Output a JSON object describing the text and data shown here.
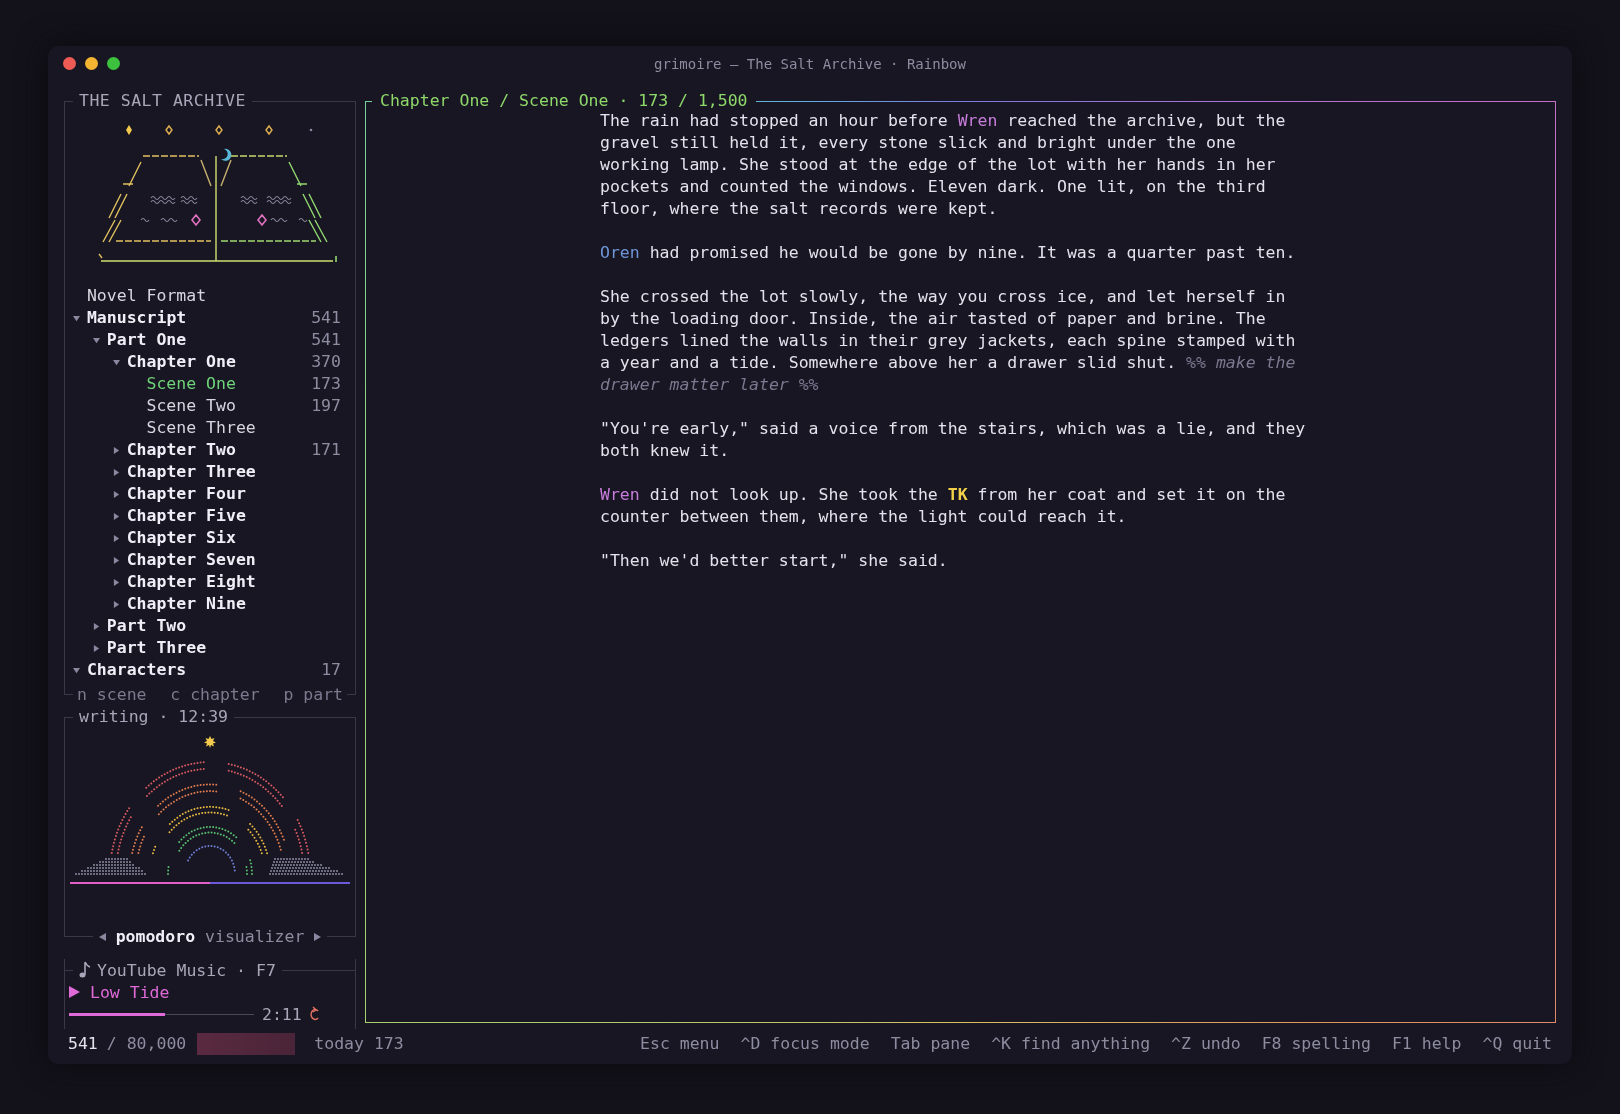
{
  "window": {
    "title": "grimoire — The Salt Archive · Rainbow"
  },
  "sidebar": {
    "title": "THE SALT ARCHIVE",
    "tree": [
      {
        "name": "Novel Format",
        "kind": "document",
        "selected": false
      },
      {
        "name": "Manuscript",
        "kind": "folder",
        "count": "541",
        "expanded": true,
        "selected": false,
        "children": [
          {
            "name": "Part One",
            "kind": "folder",
            "count": "541",
            "expanded": true,
            "selected": false,
            "children": [
              {
                "name": "Chapter One",
                "kind": "folder",
                "count": "370",
                "expanded": true,
                "selected": false,
                "children": [
                  {
                    "name": "Scene One",
                    "kind": "document",
                    "count": "173",
                    "selected": true
                  },
                  {
                    "name": "Scene Two",
                    "kind": "document",
                    "count": "197",
                    "selected": false
                  },
                  {
                    "name": "Scene Three",
                    "kind": "document",
                    "selected": false
                  }
                ]
              },
              {
                "name": "Chapter Two",
                "kind": "folder",
                "count": "171",
                "expanded": false,
                "selected": false
              },
              {
                "name": "Chapter Three",
                "kind": "folder",
                "expanded": false,
                "selected": false
              },
              {
                "name": "Chapter Four",
                "kind": "folder",
                "expanded": false,
                "selected": false
              },
              {
                "name": "Chapter Five",
                "kind": "folder",
                "expanded": false,
                "selected": false
              },
              {
                "name": "Chapter Six",
                "kind": "folder",
                "expanded": false,
                "selected": false
              },
              {
                "name": "Chapter Seven",
                "kind": "folder",
                "expanded": false,
                "selected": false
              },
              {
                "name": "Chapter Eight",
                "kind": "folder",
                "expanded": false,
                "selected": false
              },
              {
                "name": "Chapter Nine",
                "kind": "folder",
                "expanded": false,
                "selected": false
              }
            ]
          },
          {
            "name": "Part Two",
            "kind": "folder",
            "expanded": false,
            "selected": false
          },
          {
            "name": "Part Three",
            "kind": "folder",
            "expanded": false,
            "selected": false
          }
        ]
      },
      {
        "name": "Characters",
        "kind": "folder",
        "count": "17",
        "expanded": true,
        "selected": false
      }
    ],
    "hints": [
      "n scene",
      "c chapter",
      "p part"
    ]
  },
  "timer": {
    "title": "writing · 12:39",
    "level": 0.5,
    "modes": [
      {
        "label": "pomodoro",
        "selected": true
      },
      {
        "label": "visualizer",
        "selected": false
      }
    ]
  },
  "music": {
    "title": "YouTube Music · F7",
    "track": "Low Tide",
    "level": 0.52,
    "time": "2:11"
  },
  "editor": {
    "title": "Chapter One / Scene One · 173 / 1,500",
    "paragraphs": [
      [
        {
          "kind": "plain",
          "text": "The rain had stopped an hour before "
        },
        {
          "kind": "name",
          "color": "#c77ddb",
          "text": "Wren"
        },
        {
          "kind": "plain",
          "text": " reached the archive, but the gravel still held it, every stone slick and bright under the one working lamp. She stood at the edge of the lot with her hands in her pockets and counted the windows. Eleven dark. One lit, on the third floor, where the salt records were kept."
        }
      ],
      [
        {
          "kind": "name",
          "color": "#6f95d8",
          "text": "Oren"
        },
        {
          "kind": "plain",
          "text": " had promised he would be gone by nine. It was a quarter past ten."
        }
      ],
      [
        {
          "kind": "plain",
          "text": "She crossed the lot slowly, the way you cross ice, and let herself in by the loading door. Inside, the air tasted of paper and brine. The ledgers lined the walls in their grey jackets, each spine stamped with a year and a tide. Somewhere above her a drawer slid shut. "
        },
        {
          "kind": "comment",
          "text": "%% make the drawer matter later %%"
        }
      ],
      [
        {
          "kind": "plain",
          "text": "\"You're early,\" said a voice from the stairs, which was a lie, and they both knew it."
        }
      ],
      [
        {
          "kind": "name",
          "color": "#c77ddb",
          "text": "Wren"
        },
        {
          "kind": "plain",
          "text": " did not look up. She took the "
        },
        {
          "kind": "tk",
          "text": "TK"
        },
        {
          "kind": "plain",
          "text": " from her coat and set it on the counter between them, where the light could reach it."
        }
      ],
      [
        {
          "kind": "plain",
          "text": "\"Then we'd better start,\" she said."
        }
      ]
    ]
  },
  "status_bar": {
    "words": "541",
    "goal": "/ 80,000",
    "today": "today 173",
    "shortcuts": [
      {
        "key": "Esc",
        "label": "menu"
      },
      {
        "key": "^D",
        "label": "focus mode"
      },
      {
        "key": "Tab",
        "label": "pane"
      },
      {
        "key": "^K",
        "label": "find anything"
      },
      {
        "key": "^Z",
        "label": "undo"
      },
      {
        "key": "F8",
        "label": "spelling"
      },
      {
        "key": "F1",
        "label": "help"
      },
      {
        "key": "^Q",
        "label": "quit"
      }
    ]
  }
}
